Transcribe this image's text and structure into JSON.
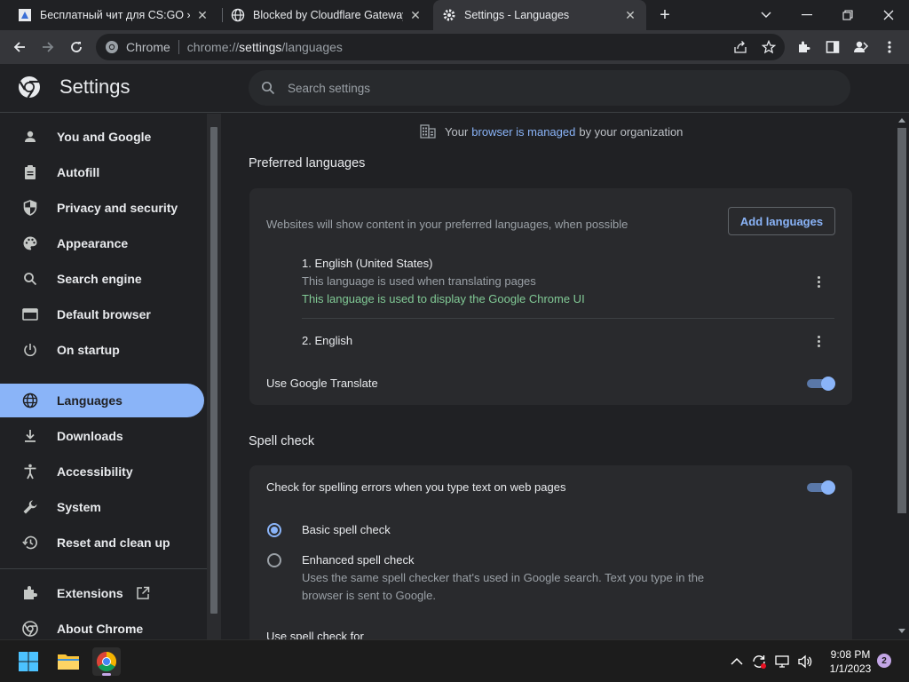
{
  "tabs": [
    {
      "title": "Бесплатный чит для CS:GO » AU",
      "icon": "site-favicon"
    },
    {
      "title": "Blocked by Cloudflare Gateway",
      "icon": "globe-icon"
    },
    {
      "title": "Settings - Languages",
      "icon": "gear-icon"
    }
  ],
  "toolbar": {
    "site_label": "Chrome",
    "url_scheme": "chrome://",
    "url_host": "settings",
    "url_path": "/languages"
  },
  "header": {
    "title": "Settings",
    "search_placeholder": "Search settings"
  },
  "sidebar": {
    "items": [
      {
        "label": "You and Google",
        "icon": "person-icon"
      },
      {
        "label": "Autofill",
        "icon": "clipboard-icon"
      },
      {
        "label": "Privacy and security",
        "icon": "shield-icon"
      },
      {
        "label": "Appearance",
        "icon": "palette-icon"
      },
      {
        "label": "Search engine",
        "icon": "search-icon"
      },
      {
        "label": "Default browser",
        "icon": "browser-icon"
      },
      {
        "label": "On startup",
        "icon": "power-icon"
      },
      {
        "label": "Languages",
        "icon": "globe-icon",
        "selected": true
      },
      {
        "label": "Downloads",
        "icon": "download-icon"
      },
      {
        "label": "Accessibility",
        "icon": "accessibility-icon"
      },
      {
        "label": "System",
        "icon": "wrench-icon"
      },
      {
        "label": "Reset and clean up",
        "icon": "history-icon"
      },
      {
        "label": "Extensions",
        "icon": "puzzle-icon"
      },
      {
        "label": "About Chrome",
        "icon": "chrome-icon"
      }
    ]
  },
  "main": {
    "managed_prefix": "Your",
    "managed_link": "browser is managed",
    "managed_suffix": "by your organization",
    "preferred": {
      "title": "Preferred languages",
      "description": "Websites will show content in your preferred languages, when possible",
      "add_button": "Add languages",
      "languages": [
        {
          "name": "1. English (United States)",
          "note1": "This language is used when translating pages",
          "note2": "This language is used to display the Google Chrome UI"
        },
        {
          "name": "2. English"
        }
      ],
      "translate_label": "Use Google Translate",
      "translate_on": true
    },
    "spell": {
      "title": "Spell check",
      "check_label": "Check for spelling errors when you type text on web pages",
      "check_on": true,
      "basic_label": "Basic spell check",
      "enhanced_label": "Enhanced spell check",
      "enhanced_desc_line1": "Uses the same spell checker that's used in Google search. Text you type in the",
      "enhanced_desc_line2": "browser is sent to Google.",
      "selected": "basic",
      "use_for": "Use spell check for"
    }
  },
  "taskbar": {
    "time": "9:08 PM",
    "date": "1/1/2023",
    "notifications": "2"
  },
  "colors": {
    "accent": "#8ab4f8",
    "success": "#81c995",
    "background": "#202124",
    "card": "#292a2d"
  }
}
